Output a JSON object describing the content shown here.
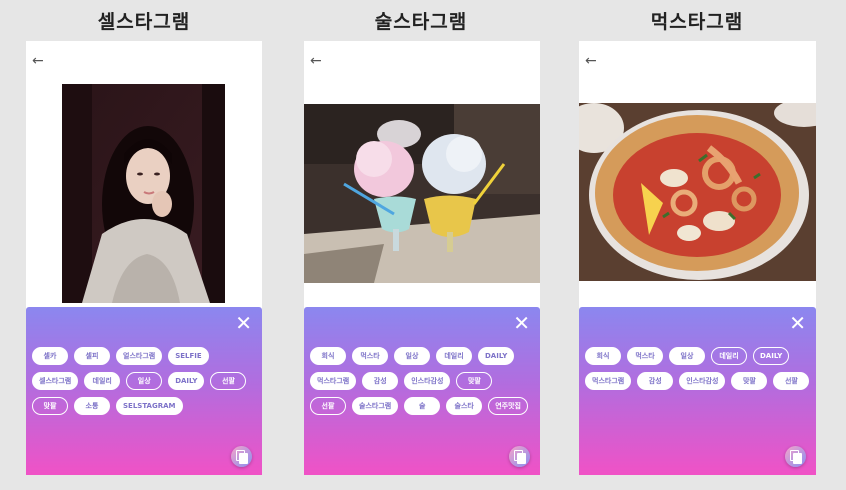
{
  "screens": [
    {
      "title": "셀스타그램",
      "back_icon": "←",
      "close_icon": "✕",
      "tags": [
        {
          "label": "셀카",
          "selected": false
        },
        {
          "label": "셀피",
          "selected": false
        },
        {
          "label": "얼스타그램",
          "selected": false
        },
        {
          "label": "SELFIE",
          "selected": false
        },
        {
          "label": "셀스타그램",
          "selected": false
        },
        {
          "label": "데일리",
          "selected": false
        },
        {
          "label": "일상",
          "selected": true
        },
        {
          "label": "DAILY",
          "selected": false
        },
        {
          "label": "선팔",
          "selected": true
        },
        {
          "label": "맞팔",
          "selected": true
        },
        {
          "label": "소통",
          "selected": false
        },
        {
          "label": "SELSTAGRAM",
          "selected": false
        }
      ]
    },
    {
      "title": "술스타그램",
      "back_icon": "←",
      "close_icon": "✕",
      "tags": [
        {
          "label": "회식",
          "selected": false
        },
        {
          "label": "먹스타",
          "selected": false
        },
        {
          "label": "일상",
          "selected": false
        },
        {
          "label": "데일리",
          "selected": false
        },
        {
          "label": "DAILY",
          "selected": false
        },
        {
          "label": "먹스타그램",
          "selected": false
        },
        {
          "label": "감성",
          "selected": false
        },
        {
          "label": "인스타감성",
          "selected": false
        },
        {
          "label": "맞팔",
          "selected": true
        },
        {
          "label": "선팔",
          "selected": true
        },
        {
          "label": "술스타그램",
          "selected": false
        },
        {
          "label": "술",
          "selected": false
        },
        {
          "label": "술스타",
          "selected": false
        },
        {
          "label": "연주맛집",
          "selected": true
        }
      ]
    },
    {
      "title": "먹스타그램",
      "back_icon": "←",
      "close_icon": "✕",
      "tags": [
        {
          "label": "회식",
          "selected": false
        },
        {
          "label": "먹스타",
          "selected": false
        },
        {
          "label": "일상",
          "selected": false
        },
        {
          "label": "데일리",
          "selected": true
        },
        {
          "label": "DAILY",
          "selected": true
        },
        {
          "label": "먹스타그램",
          "selected": false
        },
        {
          "label": "감성",
          "selected": false
        },
        {
          "label": "인스타감성",
          "selected": false
        },
        {
          "label": "맞팔",
          "selected": false
        },
        {
          "label": "선팔",
          "selected": false
        }
      ]
    }
  ]
}
